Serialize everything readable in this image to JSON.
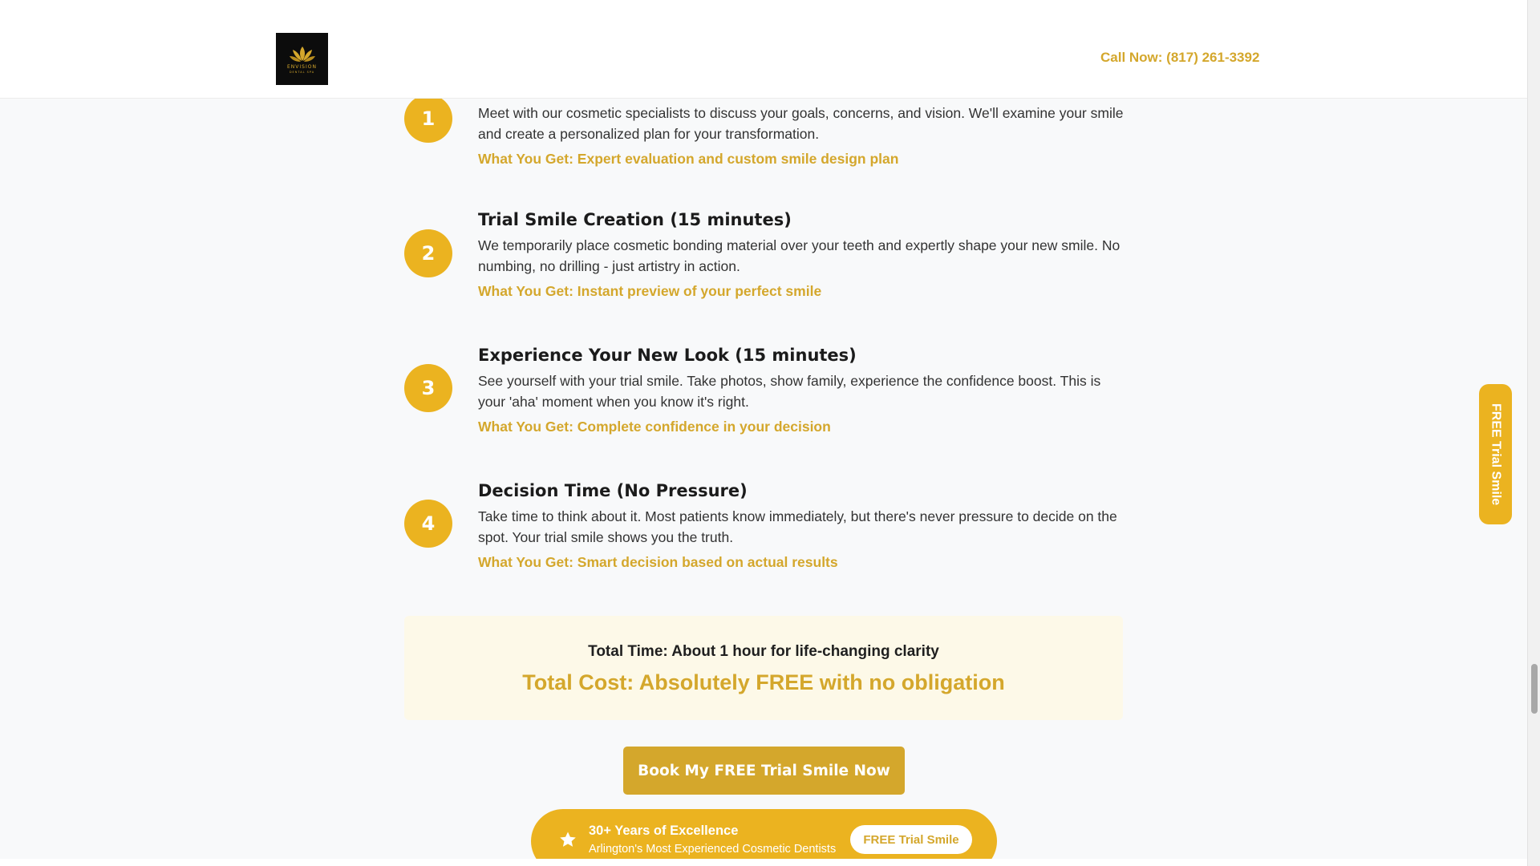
{
  "header": {
    "logo_word": "ENVISION",
    "logo_sub": "DENTAL SPA",
    "call_now": "Call Now: (817) 261-3392"
  },
  "steps": [
    {
      "number": "1",
      "title": "",
      "description": "Meet with our cosmetic specialists to discuss your goals, concerns, and vision. We'll examine your smile and create a personalized plan for your transformation.",
      "what_you_get": "What You Get: Expert evaluation and custom smile design plan"
    },
    {
      "number": "2",
      "title": "Trial Smile Creation (15 minutes)",
      "description": "We temporarily place cosmetic bonding material over your teeth and expertly shape your new smile. No numbing, no drilling - just artistry in action.",
      "what_you_get": "What You Get: Instant preview of your perfect smile"
    },
    {
      "number": "3",
      "title": "Experience Your New Look (15 minutes)",
      "description": "See yourself with your trial smile. Take photos, show family, experience the confidence boost. This is your 'aha' moment when you know it's right.",
      "what_you_get": "What You Get: Complete confidence in your decision"
    },
    {
      "number": "4",
      "title": "Decision Time (No Pressure)",
      "description": "Take time to think about it. Most patients know immediately, but there's never pressure to decide on the spot. Your trial smile shows you the truth.",
      "what_you_get": "What You Get: Smart decision based on actual results"
    }
  ],
  "totals": {
    "time": "Total Time: About 1 hour for life-changing clarity",
    "cost": "Total Cost: Absolutely FREE with no obligation"
  },
  "cta": {
    "book_label": "Book My FREE Trial Smile Now"
  },
  "badge": {
    "icon": "star-icon",
    "title": "30+ Years of Excellence",
    "subtitle": "Arlington's Most Experienced Cosmetic Dentists",
    "button_label": "FREE Trial Smile"
  },
  "side_tab": {
    "label": "FREE Trial Smile"
  },
  "colors": {
    "gold": "#d4a72c",
    "gold_bright": "#ebb320",
    "cream": "#fdf9e8",
    "background": "#f8f9fa"
  }
}
